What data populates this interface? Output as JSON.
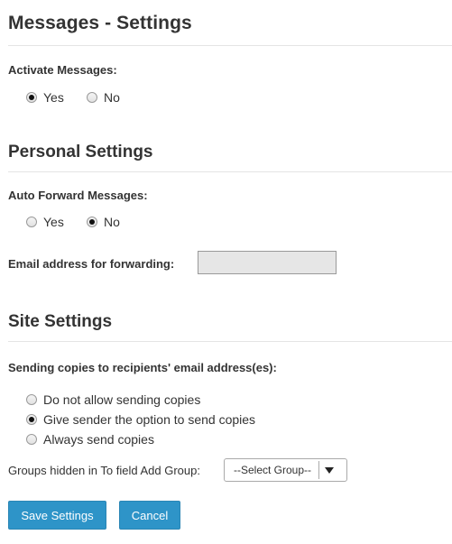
{
  "title": "Messages - Settings",
  "activate": {
    "label": "Activate Messages:",
    "options": [
      {
        "label": "Yes",
        "checked": true
      },
      {
        "label": "No",
        "checked": false
      }
    ]
  },
  "personal": {
    "heading": "Personal Settings",
    "forward_label": "Auto Forward Messages:",
    "forward_options": [
      {
        "label": "Yes",
        "checked": false
      },
      {
        "label": "No",
        "checked": true
      }
    ],
    "email_label": "Email address for forwarding:",
    "email_value": ""
  },
  "site": {
    "heading": "Site Settings",
    "copies_label": "Sending copies to recipients' email address(es):",
    "copies_options": [
      {
        "label": "Do not allow sending copies",
        "checked": false
      },
      {
        "label": "Give sender the option to send copies",
        "checked": true
      },
      {
        "label": "Always send copies",
        "checked": false
      }
    ],
    "groups_label": "Groups hidden in To field Add Group:",
    "groups_select": "--Select Group--"
  },
  "buttons": {
    "save": "Save Settings",
    "cancel": "Cancel"
  }
}
